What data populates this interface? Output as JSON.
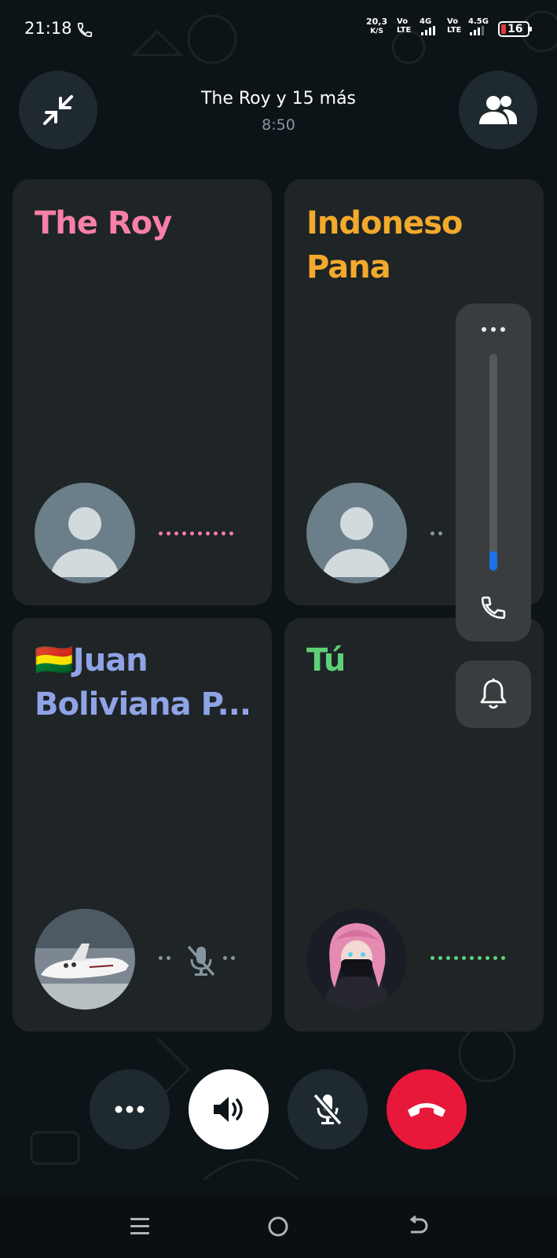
{
  "status_bar": {
    "time": "21:18",
    "net_speed_value": "20,3",
    "net_speed_unit": "K/S",
    "sim1_top": "Vo",
    "sim1_bottom": "LTE",
    "sim1_gen": "4G",
    "sim2_top": "Vo",
    "sim2_bottom": "LTE",
    "sim2_gen": "4.5G",
    "battery": "16",
    "battery_color": "#e53935"
  },
  "header": {
    "title": "The Roy y 15 más",
    "timer": "8:50",
    "minimize_icon": "minimize-arrows-icon",
    "participants_icon": "group-icon"
  },
  "participants": [
    {
      "name": "The Roy",
      "color": "#f77fa8",
      "avatar": "default-avatar",
      "status": "speaking-dots"
    },
    {
      "name": "Indoneso Pana",
      "color": "#f2a92c",
      "avatar": "default-avatar",
      "status": "connecting-dots"
    },
    {
      "name": "🇧🇴Juan Boliviana P...",
      "color": "#8fa3e6",
      "avatar": "airplane-photo",
      "status": "muted"
    },
    {
      "name": "Tú",
      "color": "#5ed178",
      "avatar": "anime-photo",
      "status": "speaking-dots"
    }
  ],
  "volume_panel": {
    "level": 0.09,
    "accent": "#1a73e8",
    "more_icon": "more-dots-icon",
    "call_icon": "phone-icon",
    "notification_icon": "bell-icon"
  },
  "controls": {
    "more_icon": "more-dots-icon",
    "speaker_icon": "speaker-icon",
    "mute_icon": "mic-off-icon",
    "end_call_icon": "end-call-icon",
    "end_call_color": "#e8183a"
  },
  "nav": {
    "menu_icon": "menu-icon",
    "home_icon": "home-circle-icon",
    "back_icon": "back-icon"
  }
}
